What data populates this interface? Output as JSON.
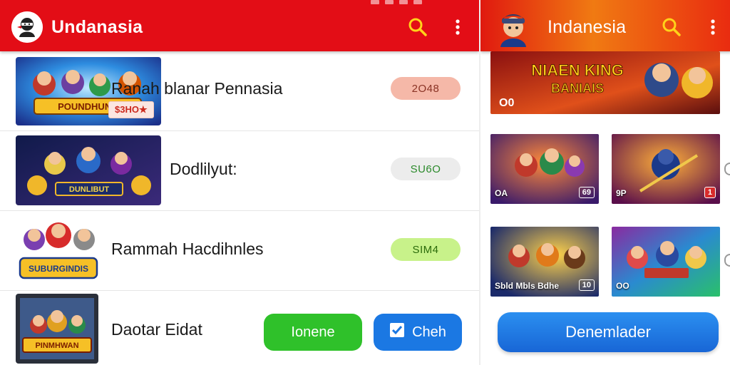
{
  "left_panel": {
    "title": "Undanasia",
    "items": [
      {
        "title": "Ranah blanar Pennasia",
        "thumb_caption": "POUNDHUNS",
        "tag": "$3HO★",
        "pill": "2O48",
        "pill_color": "#f5b8a8",
        "pill_text_color": "#8a3325"
      },
      {
        "title": "Dodlilyut:",
        "thumb_caption": "DUNLIBUT",
        "pill": "SU6O",
        "pill_color": "#ececec",
        "pill_text_color": "#2b8a2b"
      },
      {
        "title": "Rammah Hacdihnles",
        "thumb_caption": "SUBURGINDIS",
        "pill": "SIM4",
        "pill_color": "#c8f28a",
        "pill_text_color": "#2a6a0a"
      },
      {
        "title": "Daotar Eidat",
        "thumb_caption": "PINMHWAN"
      }
    ],
    "buttons": {
      "green_label": "Ionene",
      "blue_label": "Cheh"
    }
  },
  "right_panel": {
    "title": "Indanesia",
    "banner": {
      "headline": "NIAEN KING",
      "subline": "BANIAIS",
      "corner_label": "O0"
    },
    "cards": [
      {
        "label": "OA",
        "badge": "69"
      },
      {
        "label": "9P",
        "badge": "1"
      },
      {
        "label": "Sbld Mbls Bdhe",
        "badge": "10"
      },
      {
        "label": "OO",
        "badge": ""
      }
    ],
    "primary_button": "Denemlader"
  },
  "colors": {
    "appbar_red": "#e30d16",
    "green_button": "#2fc12a",
    "blue_button": "#1b78e3"
  }
}
